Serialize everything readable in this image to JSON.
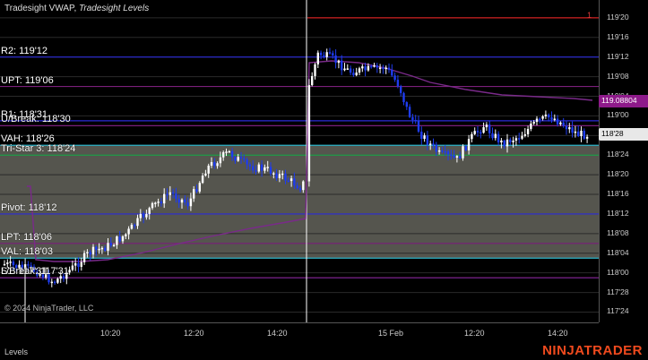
{
  "window": {
    "indicator_title": "Tradesight VWAP,",
    "indicator_subtitle": "Tradesight Levels"
  },
  "levels": [
    {
      "label": "R2: 119'12",
      "price": 119.375,
      "color": "#2b2bd8"
    },
    {
      "label": "UPT: 119'06",
      "price": 119.1875,
      "color": "#7a1f7a"
    },
    {
      "label": "R1: 118'31",
      "price": 118.96875,
      "color": "#2b2bd8"
    },
    {
      "label": "U/Break: 118'30",
      "price": 118.9375,
      "color": "#7a1f7a"
    },
    {
      "label": "VAH: 118'26",
      "price": 118.8125,
      "color": "#2bb3c8"
    },
    {
      "label": "Tri-Star 3: 118'24",
      "price": 118.75,
      "color": "#22a04a"
    },
    {
      "label": "Pivot: 118'12",
      "price": 118.375,
      "color": "#2b2bd8"
    },
    {
      "label": "LPT: 118'06",
      "price": 118.1875,
      "color": "#7a1f7a"
    },
    {
      "label": "VAL: 118'03",
      "price": 118.09375,
      "color": "#2bb3c8"
    },
    {
      "label": "S1: 117'31",
      "price": 117.96875,
      "color": "#2b2bd8"
    },
    {
      "label": "L/Break: 117'31",
      "price": 117.96875,
      "color": "#7a1f7a"
    }
  ],
  "top_level": {
    "price": 119.625,
    "color": "#d02020",
    "marker": "1"
  },
  "y_axis": {
    "ticks": [
      "119'20",
      "119'16",
      "119'12",
      "119'08",
      "119'04",
      "119'00",
      "118'28",
      "118'24",
      "118'20",
      "118'16",
      "118'12",
      "118'08",
      "118'04",
      "118'00",
      "117'28",
      "117'24"
    ],
    "tick_values": [
      119.625,
      119.5,
      119.375,
      119.25,
      119.125,
      119.0,
      118.875,
      118.75,
      118.625,
      118.5,
      118.375,
      118.25,
      118.125,
      118.0,
      117.875,
      117.75
    ],
    "min": 117.73,
    "max": 119.67
  },
  "x_axis": {
    "ticks": [
      "10:20",
      "12:20",
      "14:20",
      "15 Feb",
      "12:20",
      "14:20"
    ]
  },
  "price_tags": {
    "vwap_value": "119.08804",
    "last_price": "118'28"
  },
  "copyright": "© 2024 NinjaTrader, LLC",
  "tabs": {
    "active": "Levels"
  },
  "brand": "NINJATRADER",
  "colors": {
    "background": "#000000",
    "value_area": "#55554e",
    "vwap": "#7a2a8a",
    "candle_up": "#ffffff",
    "candle_down": "#1e3cf0",
    "session_divider": "#ffffff"
  }
}
